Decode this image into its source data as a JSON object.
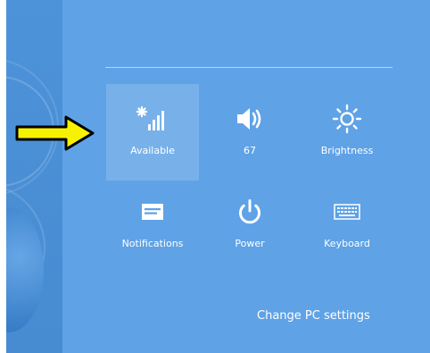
{
  "settings_panel": {
    "quick_settings": [
      {
        "id": "network",
        "label": "Available",
        "icon": "wifi-signal-icon"
      },
      {
        "id": "volume",
        "label": "67",
        "icon": "speaker-icon"
      },
      {
        "id": "brightness",
        "label": "Brightness",
        "icon": "sun-icon"
      },
      {
        "id": "notifications",
        "label": "Notifications",
        "icon": "notifications-icon"
      },
      {
        "id": "power",
        "label": "Power",
        "icon": "power-icon"
      },
      {
        "id": "keyboard",
        "label": "Keyboard",
        "icon": "keyboard-icon"
      }
    ],
    "change_pc_settings_label": "Change PC settings",
    "selected_item": "network"
  },
  "colors": {
    "panel_background": "#5fa2e6",
    "strip_background": "#4a8fd6",
    "arrow_fill": "#f7f200",
    "arrow_outline": "#000000"
  }
}
